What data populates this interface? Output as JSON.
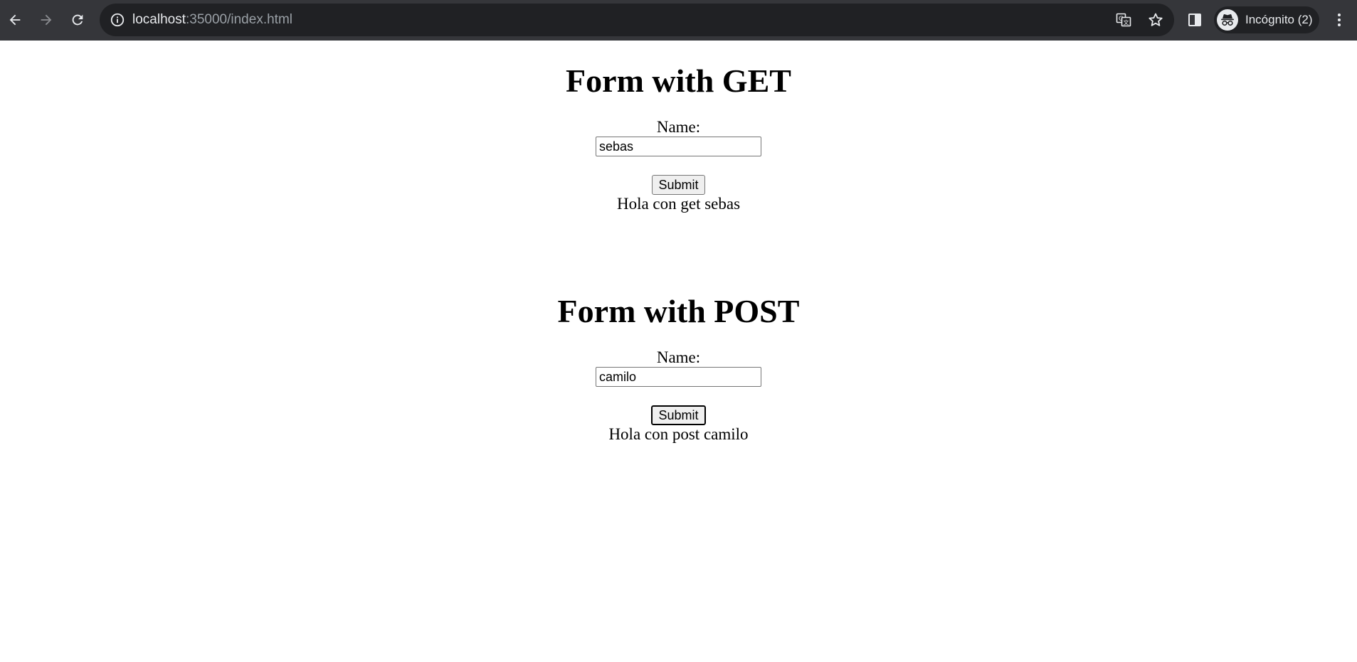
{
  "browser": {
    "url_host": "localhost",
    "url_rest": ":35000/index.html",
    "profile_label": "Incógnito (2)",
    "icons": {
      "back": "arrow-back-icon",
      "forward": "arrow-forward-icon",
      "reload": "reload-icon",
      "site_info": "info-icon",
      "translate": "translate-icon",
      "bookmark": "star-icon",
      "side_panel": "side-panel-icon",
      "incognito": "incognito-icon",
      "menu": "kebab-menu-icon"
    },
    "colors": {
      "toolbar_bg": "#35363a",
      "omnibox_bg": "#202124",
      "text_primary": "#e8eaed",
      "text_secondary": "#9aa0a6"
    }
  },
  "get_form": {
    "title": "Form with GET",
    "name_label": "Name:",
    "name_value": "sebas",
    "submit_label": "Submit",
    "result": "Hola con get sebas"
  },
  "post_form": {
    "title": "Form with POST",
    "name_label": "Name:",
    "name_value": "camilo",
    "submit_label": "Submit",
    "result": "Hola con post camilo"
  }
}
